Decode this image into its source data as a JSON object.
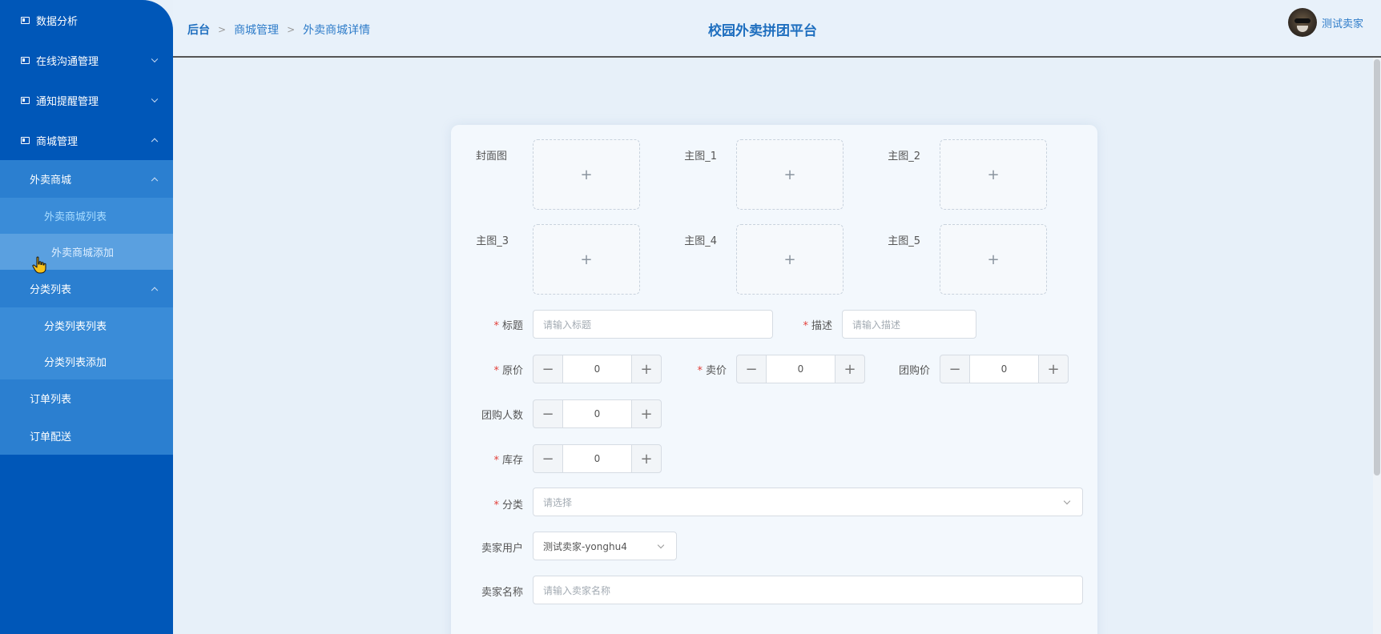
{
  "sidebar": {
    "items": [
      {
        "label": "数据分析"
      },
      {
        "label": "在线沟通管理"
      },
      {
        "label": "通知提醒管理"
      },
      {
        "label": "商城管理"
      }
    ],
    "sub": {
      "takeaway": "外卖商城",
      "takeaway_list": "外卖商城列表",
      "takeaway_add": "外卖商城添加",
      "category": "分类列表",
      "category_list": "分类列表列表",
      "category_add": "分类列表添加",
      "order_list": "订单列表",
      "order_delivery": "订单配送"
    }
  },
  "header": {
    "breadcrumb": [
      "后台",
      "商城管理",
      "外卖商城详情"
    ],
    "title": "校园外卖拼团平台",
    "user_name": "测试卖家"
  },
  "form": {
    "uploads": [
      {
        "label": "封面图",
        "icon": "plus-icon",
        "glyph": "+"
      },
      {
        "label": "主图_1",
        "icon": "plus-icon",
        "glyph": "+"
      },
      {
        "label": "主图_2",
        "icon": "plus-icon",
        "glyph": "+"
      },
      {
        "label": "主图_3",
        "icon": "plus-icon",
        "glyph": "+"
      },
      {
        "label": "主图_4",
        "icon": "plus-icon",
        "glyph": "+"
      },
      {
        "label": "主图_5",
        "icon": "plus-icon",
        "glyph": "+"
      }
    ],
    "title_label": "标题",
    "title_placeholder": "请输入标题",
    "desc_label": "描述",
    "desc_placeholder": "请输入描述",
    "original_price_label": "原价",
    "original_price": "0",
    "sale_price_label": "卖价",
    "sale_price": "0",
    "group_price_label": "团购价",
    "group_price": "0",
    "group_count_label": "团购人数",
    "group_count": "0",
    "stock_label": "库存",
    "stock": "0",
    "category_label": "分类",
    "category_placeholder": "请选择",
    "seller_user_label": "卖家用户",
    "seller_user_value": "测试卖家-yonghu4",
    "seller_name_label": "卖家名称",
    "seller_name_placeholder": "请输入卖家名称",
    "minus": "−",
    "plus": "+"
  }
}
